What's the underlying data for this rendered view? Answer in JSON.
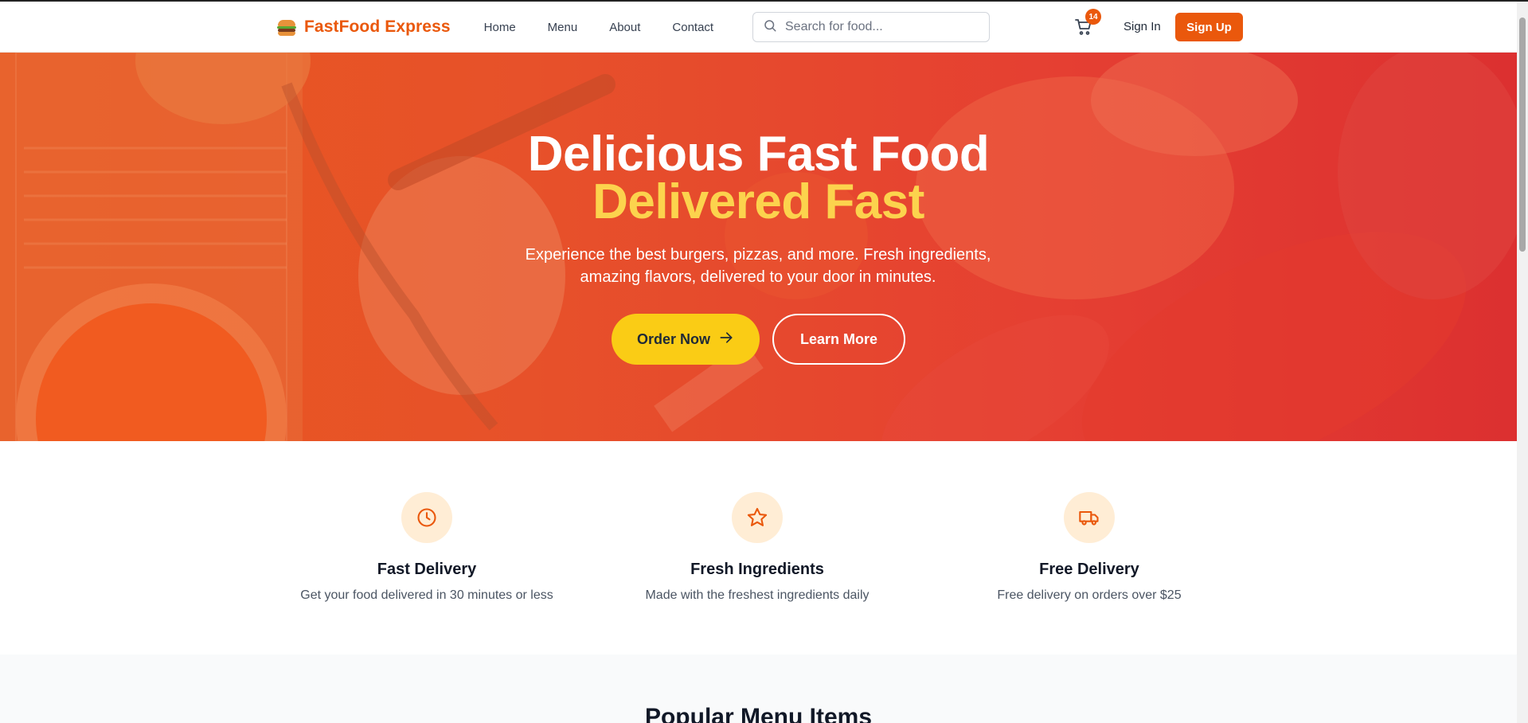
{
  "brand": {
    "name": "FastFood Express",
    "logo_icon": "burger-icon"
  },
  "nav": {
    "links": [
      "Home",
      "Menu",
      "About",
      "Contact"
    ]
  },
  "search": {
    "placeholder": "Search for food...",
    "icon": "search-icon"
  },
  "cart": {
    "count": "14",
    "icon": "cart-icon"
  },
  "auth": {
    "signin": "Sign In",
    "signup": "Sign Up"
  },
  "hero": {
    "title_line1": "Delicious Fast Food",
    "title_line2": "Delivered Fast",
    "subtitle": "Experience the best burgers, pizzas, and more. Fresh ingredients, amazing flavors, delivered to your door in minutes.",
    "primary_button": "Order Now",
    "secondary_button": "Learn More"
  },
  "features": [
    {
      "icon": "clock-icon",
      "title": "Fast Delivery",
      "desc": "Get your food delivered in 30 minutes or less"
    },
    {
      "icon": "star-icon",
      "title": "Fresh Ingredients",
      "desc": "Made with the freshest ingredients daily"
    },
    {
      "icon": "truck-icon",
      "title": "Free Delivery",
      "desc": "Free delivery on orders over $25"
    }
  ],
  "popular": {
    "title": "Popular Menu Items"
  },
  "colors": {
    "brand": "#ea580c",
    "accent_yellow": "#facc15",
    "title_yellow": "#fcd34d",
    "feature_bg": "#ffedd5"
  }
}
